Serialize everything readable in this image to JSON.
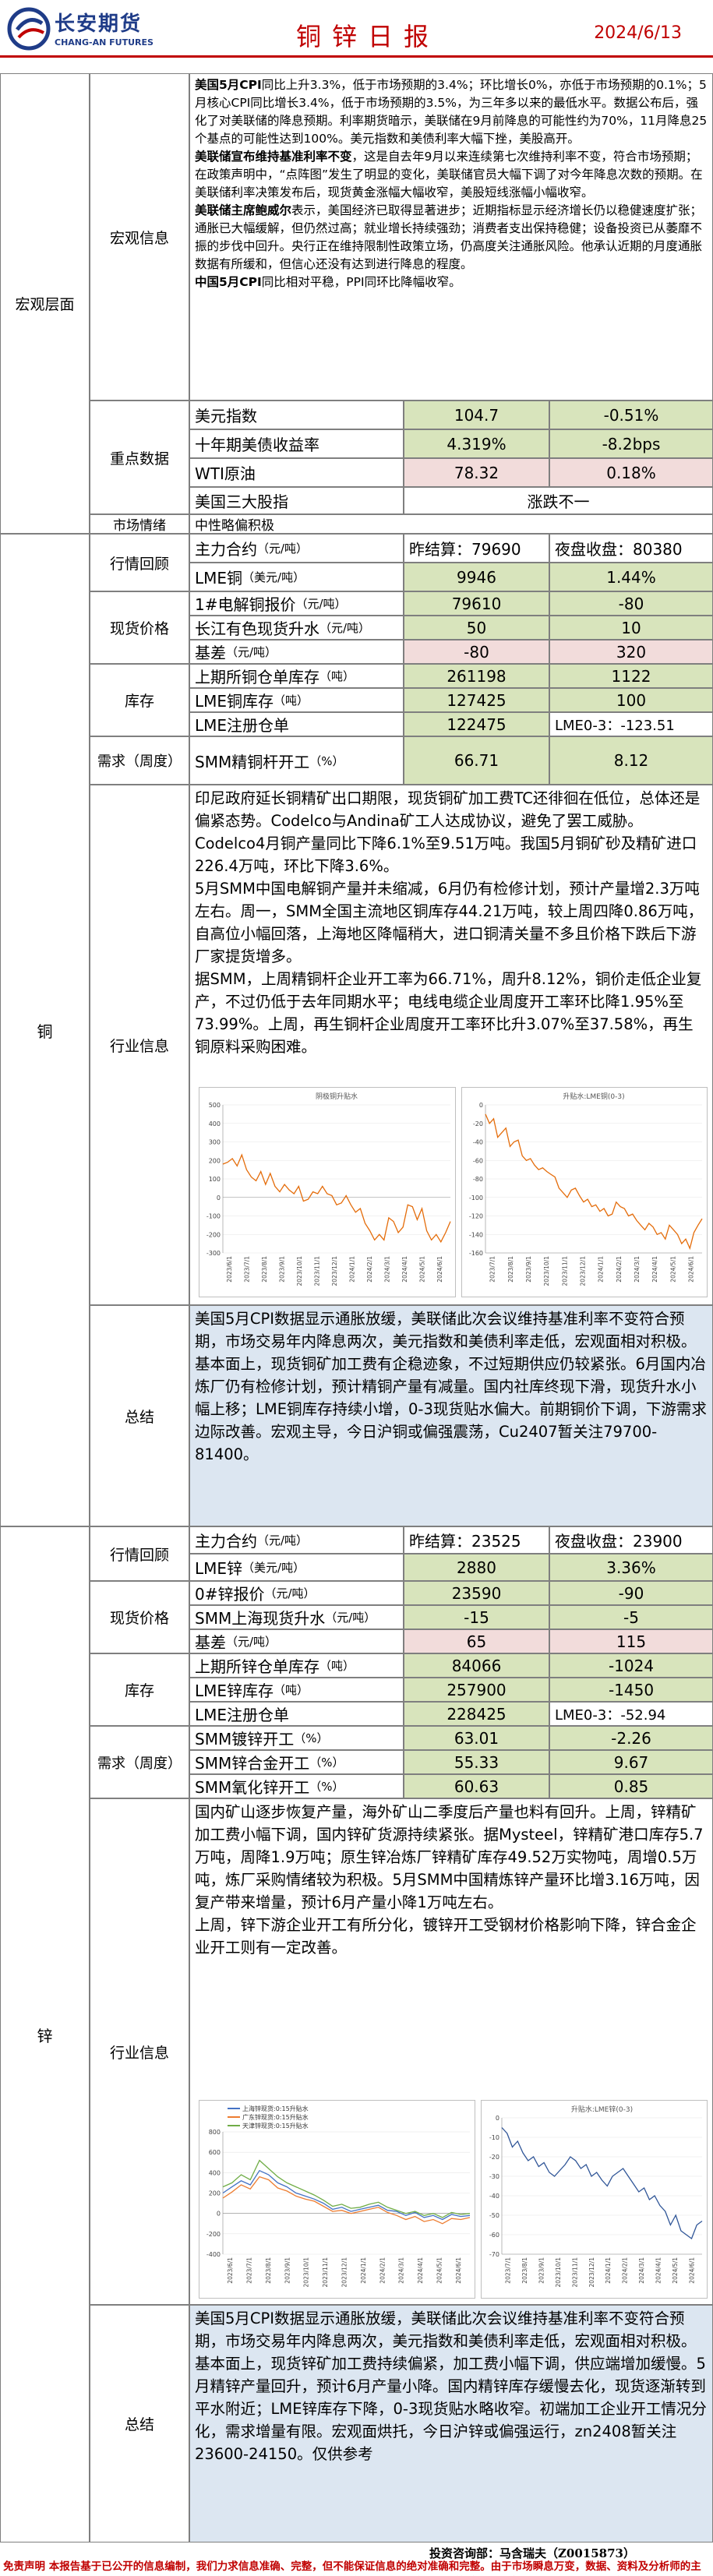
{
  "header": {
    "brand_cn": "长安期货",
    "brand_en": "CHANG-AN FUTURES",
    "title": "铜锌日报",
    "date": "2024/6/13"
  },
  "colors": {
    "green": "#d8e4bc",
    "pink": "#f2dcdb",
    "blue": "#dce6f1",
    "red": "#c00000",
    "navy": "#1f3c88"
  },
  "macro": {
    "section": "宏观层面",
    "info_label": "宏观信息",
    "paras": [
      {
        "bold": "美国5月CPI",
        "text": "同比上升3.3%，低于市场预期的3.4%；环比增长0%，亦低于市场预期的0.1%；5月核心CPI同比增长3.4%，低于市场预期的3.5%，为三年多以来的最低水平。数据公布后，强化了对美联储的降息预期。利率期货暗示，美联储在9月前降息的可能性约为70%，11月降息25个基点的可能性达到100%。美元指数和美债利率大幅下挫，美股高开。"
      },
      {
        "bold": "美联储宣布维持基准利率不变",
        "text": "，这是自去年9月以来连续第七次维持利率不变，符合市场预期；在政策声明中，“点阵图”发生了明显的变化，美联储官员大幅下调了对今年降息次数的预期。在美联储利率决策发布后，现货黄金涨幅大幅收窄，美股短线涨幅小幅收窄。"
      },
      {
        "bold": "美联储主席鲍威尔",
        "text": "表示，美国经济已取得显著进步；近期指标显示经济增长仍以稳健速度扩张；通胀已大幅缓解，但仍然过高；就业增长持续强劲；消费者支出保持稳健；设备投资已从萎靡不振的步伐中回升。央行正在维持限制性政策立场，仍高度关注通胀风险。他承认近期的月度通胀数据有所缓和，但信心还没有达到进行降息的程度。"
      },
      {
        "bold": "中国5月CPI",
        "text": "同比相对平稳，PPI同环比降幅收窄。"
      }
    ],
    "key_label": "重点数据",
    "key_rows": [
      {
        "name": "美元指数",
        "value": "104.7",
        "change": "-0.51%"
      },
      {
        "name": "十年期美债收益率",
        "value": "4.319%",
        "change": "-8.2bps"
      },
      {
        "name": "WTI原油",
        "value": "78.32",
        "change": "0.18%"
      },
      {
        "name": "美国三大股指",
        "value": "",
        "change": "涨跌不一"
      }
    ],
    "mood_label": "市场情绪",
    "mood": "中性略偏积极"
  },
  "copper": {
    "section": "铜",
    "quote_label": "行情回顾",
    "r1": {
      "name": "主力合约",
      "unit": "（元/吨）",
      "v1": "昨结算：79690",
      "v2": "夜盘收盘：80380"
    },
    "r2": {
      "name": "LME铜",
      "unit": "（美元/吨）",
      "v1": "9946",
      "v2": "1.44%"
    },
    "spot_label": "现货价格",
    "r3": {
      "name": "1#电解铜报价",
      "unit": "（元/吨）",
      "v1": "79610",
      "v2": "-80"
    },
    "r4": {
      "name": "长江有色现货升水",
      "unit": "（元/吨）",
      "v1": "50",
      "v2": "10"
    },
    "r5": {
      "name": "基差",
      "unit": "（元/吨）",
      "v1": "-80",
      "v2": "320"
    },
    "inv_label": "库存",
    "r6": {
      "name": "上期所铜仓单库存",
      "unit": "（吨）",
      "v1": "261198",
      "v2": "1122"
    },
    "r7": {
      "name": "LME铜库存",
      "unit": "（吨）",
      "v1": "127425",
      "v2": "100"
    },
    "r8": {
      "name": "LME注册仓单",
      "unit": "",
      "v1": "122475",
      "v2": "LME0-3：-123.51"
    },
    "demand_label": "需求（周度）",
    "r9": {
      "name": "SMM精铜杆开工",
      "unit": "（%）",
      "v1": "66.71",
      "v2": "8.12"
    },
    "ind_label": "行业信息",
    "ind_text": "印尼政府延长铜精矿出口期限，现货铜矿加工费TC还徘徊在低位，总体还是偏紧态势。Codelco与Andina矿工人达成协议，避免了罢工威胁。Codelco4月铜产量同比下降6.1%至9.51万吨。我国5月铜矿砂及精矿进口226.4万吨，环比下降3.6%。\n5月SMM中国电解铜产量并未缩减，6月仍有检修计划，预计产量增2.3万吨左右。周一，SMM全国主流地区铜库存44.21万吨，较上周四降0.86万吨，自高位小幅回落，上海地区降幅稍大，进口铜清关量不多且价格下跌后下游厂家提货增多。\n据SMM，上周精铜杆企业开工率为66.71%，周升8.12%，铜价走低企业复产，不过仍低于去年同期水平；电线电缆企业周度开工率环比降1.95%至73.99%。上周，再生铜杆企业周度开工率环比升3.07%至37.58%，再生铜原料采购困难。",
    "sum_label": "总结",
    "sum_text": "美国5月CPI数据显示通胀放缓，美联储此次会议维持基准利率不变符合预期，市场交易年内降息两次，美元指数和美债利率走低，宏观面相对积极。基本面上，现货铜矿加工费有企稳迹象，不过短期供应仍较紧张。6月国内冶炼厂仍有检修计划，预计精铜产量有减量。国内社库终现下滑，现货升水小幅上移；LME铜库存持续小增，0-3现货贴水偏大。前期铜价下调，下游需求边际改善。宏观主导，今日沪铜或偏强震荡，Cu2407暂关注79700-81400。",
    "chart1": {
      "type": "line",
      "title": "阴极铜升贴水",
      "yticks": [
        "-300",
        "-200",
        "-100",
        "0",
        "100",
        "200",
        "300",
        "400",
        "500"
      ],
      "xticks": [
        "2023/6/1",
        "2023/7/1",
        "2023/8/1",
        "2023/9/1",
        "2023/10/1",
        "2023/11/1",
        "2023/12/1",
        "2024/1/1",
        "2024/2/1",
        "2024/3/1",
        "2024/4/1",
        "2024/5/1",
        "2024/6/1"
      ],
      "ylim": [
        -300,
        500
      ],
      "values": [
        180,
        190,
        210,
        170,
        230,
        150,
        110,
        90,
        140,
        70,
        130,
        60,
        30,
        70,
        40,
        20,
        60,
        -20,
        -10,
        30,
        20,
        60,
        20,
        10,
        -40,
        -30,
        10,
        -40,
        -80,
        -60,
        -140,
        -180,
        -230,
        -200,
        -230,
        -110,
        -130,
        -190,
        -160,
        -40,
        -50,
        -120,
        -60,
        -180,
        -230,
        -200,
        -240,
        -190,
        -130
      ]
    },
    "chart2": {
      "type": "line",
      "title": "升贴水:LME铜(0-3)",
      "yticks": [
        "-160",
        "-140",
        "-120",
        "-100",
        "-80",
        "-60",
        "-40",
        "-20",
        "0"
      ],
      "xticks": [
        "2023/7/1",
        "2023/8/1",
        "2023/9/1",
        "2023/10/1",
        "2023/11/1",
        "2023/12/1",
        "2024/1/1",
        "2024/2/1",
        "2024/3/1",
        "2024/4/1",
        "2024/5/1",
        "2024/6/1"
      ],
      "ylim": [
        -160,
        0
      ],
      "values": [
        -10,
        -20,
        -15,
        -35,
        -30,
        -25,
        -45,
        -40,
        -38,
        -55,
        -60,
        -58,
        -65,
        -70,
        -68,
        -72,
        -75,
        -78,
        -90,
        -95,
        -100,
        -92,
        -90,
        -98,
        -105,
        -102,
        -110,
        -108,
        -115,
        -112,
        -120,
        -118,
        -105,
        -110,
        -112,
        -120,
        -118,
        -125,
        -130,
        -135,
        -128,
        -132,
        -140,
        -138,
        -145,
        -130,
        -135,
        -140,
        -150,
        -145,
        -155,
        -138,
        -130,
        -123
      ]
    }
  },
  "zinc": {
    "section": "锌",
    "quote_label": "行情回顾",
    "r1": {
      "name": "主力合约",
      "unit": "（元/吨）",
      "v1": "昨结算：23525",
      "v2": "夜盘收盘：23900"
    },
    "r2": {
      "name": "LME锌",
      "unit": "（美元/吨）",
      "v1": "2880",
      "v2": "3.36%"
    },
    "spot_label": "现货价格",
    "r3": {
      "name": "0#锌报价",
      "unit": "（元/吨）",
      "v1": "23590",
      "v2": "-90"
    },
    "r4": {
      "name": "SMM上海现货升水",
      "unit": "（元/吨）",
      "v1": "-15",
      "v2": "-5"
    },
    "r5": {
      "name": "基差",
      "unit": "（元/吨）",
      "v1": "65",
      "v2": "115"
    },
    "inv_label": "库存",
    "r6": {
      "name": "上期所锌仓单库存",
      "unit": "（吨）",
      "v1": "84066",
      "v2": "-1024"
    },
    "r7": {
      "name": "LME锌库存",
      "unit": "（吨）",
      "v1": "257900",
      "v2": "-1450"
    },
    "r8": {
      "name": "LME注册仓单",
      "unit": "",
      "v1": "228425",
      "v2": "LME0-3：-52.94"
    },
    "demand_label": "需求（周度）",
    "r9": {
      "name": "SMM镀锌开工",
      "unit": "（%）",
      "v1": "63.01",
      "v2": "-2.26"
    },
    "r10": {
      "name": "SMM锌合金开工",
      "unit": "（%）",
      "v1": "55.33",
      "v2": "9.67"
    },
    "r11": {
      "name": "SMM氧化锌开工",
      "unit": "（%）",
      "v1": "60.63",
      "v2": "0.85"
    },
    "ind_label": "行业信息",
    "ind_text": "国内矿山逐步恢复产量，海外矿山二季度后产量也料有回升。上周，锌精矿加工费小幅下调，国内锌矿货源持续紧张。据Mysteel，锌精矿港口库存5.7万吨，周降1.9万吨；原生锌冶炼厂锌精矿库存49.52万实物吨，周增0.5万吨，炼厂采购情绪较为积极。5月SMM中国精炼锌产量环比增3.16万吨，因复产带来增量，预计6月产量小降1万吨左右。\n上周，锌下游企业开工有所分化，镀锌开工受钢材价格影响下降，锌合金企业开工则有一定改善。",
    "sum_label": "总结",
    "sum_text": "美国5月CPI数据显示通胀放缓，美联储此次会议维持基准利率不变符合预期，市场交易年内降息两次，美元指数和美债利率走低，宏观面相对积极。基本面上，现货锌矿加工费持续偏紧，加工费小幅下调，供应端增加缓慢。5月精锌产量回升，预计6月产量小降。国内精锌库存缓慢去化，现货逐渐转到平水附近；LME锌库存下降，0-3现货贴水略收窄。初端加工企业开工情况分化，需求增量有限。宏观面烘托，今日沪锌或偏强运行，zn2408暂关注23600-24150。仅供参考",
    "chart1": {
      "type": "line",
      "legend": [
        "上海锌现货:0:15升贴水",
        "广东锌现货:0:15升贴水",
        "天津锌现货:0:15升贴水"
      ],
      "yticks": [
        "-400",
        "-200",
        "0",
        "200",
        "400",
        "600",
        "800"
      ],
      "xticks": [
        "2023/6/1",
        "2023/7/1",
        "2023/8/1",
        "2023/9/1",
        "2023/10/1",
        "2023/11/1",
        "2023/12/1",
        "2024/1/1",
        "2024/2/1",
        "2024/3/1",
        "2024/4/1",
        "2024/5/1",
        "2024/6/1"
      ],
      "ylim": [
        -400,
        800
      ],
      "series": [
        {
          "name": "上海锌现货:0:15升贴水",
          "color": "#4472c4",
          "values": [
            200,
            260,
            320,
            280,
            420,
            380,
            300,
            260,
            200,
            170,
            140,
            100,
            40,
            60,
            20,
            40,
            60,
            80,
            30,
            20,
            -20,
            10,
            -40,
            -20,
            -60,
            -10,
            -30,
            -20
          ]
        },
        {
          "name": "广东锌现货:0:15升贴水",
          "color": "#ed7d31",
          "values": [
            150,
            210,
            280,
            240,
            360,
            330,
            250,
            220,
            170,
            140,
            120,
            70,
            20,
            30,
            0,
            20,
            40,
            60,
            10,
            -20,
            -60,
            -30,
            -80,
            -60,
            -100,
            -50,
            -60,
            -40
          ]
        },
        {
          "name": "天津锌现货:0:15升贴水",
          "color": "#70ad47",
          "values": [
            260,
            300,
            380,
            330,
            520,
            440,
            360,
            300,
            260,
            220,
            180,
            130,
            70,
            90,
            50,
            60,
            90,
            110,
            60,
            30,
            0,
            20,
            -20,
            0,
            -40,
            10,
            -10,
            0
          ]
        }
      ]
    },
    "chart2": {
      "type": "line",
      "title": "升贴水:LME锌(0-3)",
      "yticks": [
        "-70",
        "-60",
        "-50",
        "-40",
        "-30",
        "-20",
        "-10",
        "0"
      ],
      "xticks": [
        "2023/7/1",
        "2023/8/1",
        "2023/9/1",
        "2023/10/1",
        "2023/11/1",
        "2023/12/1",
        "2024/1/1",
        "2024/2/1",
        "2024/3/1",
        "2024/4/1",
        "2024/5/1",
        "2024/6/1"
      ],
      "ylim": [
        -70,
        0
      ],
      "values": [
        -5,
        -8,
        -15,
        -12,
        -18,
        -22,
        -20,
        -25,
        -23,
        -28,
        -30,
        -27,
        -24,
        -20,
        -22,
        -26,
        -24,
        -30,
        -28,
        -32,
        -35,
        -30,
        -28,
        -26,
        -30,
        -34,
        -38,
        -36,
        -42,
        -40,
        -45,
        -48,
        -55,
        -50,
        -58,
        -60,
        -62,
        -55,
        -53
      ]
    }
  },
  "footer": {
    "analyst": "投资咨询部：马含瑞夫（Z0015873）",
    "disc_title": "免责声明",
    "disc_text": "本报告基于已公开的信息编制，我们力求信息准确、完整，但不能保证信息的绝对准确和完整。由于市场瞬息万变，数据、资料及分析师的主观判断性，文中建议仅供参考，不能直接作为交易依据，使用者需结合自身实际情况，独立做出决策并承担相应后果；凡据本报告入市者，本公司并不承担由此引起的任何法律责任。"
  }
}
